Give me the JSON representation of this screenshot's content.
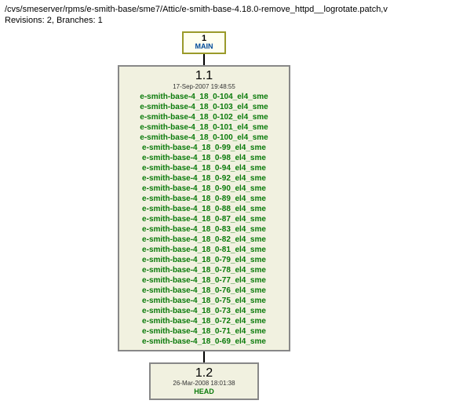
{
  "header": {
    "path": "/cvs/smeserver/rpms/e-smith-base/sme7/Attic/e-smith-base-4.18.0-remove_httpd__logrotate.patch,v",
    "revline": "Revisions: 2, Branches: 1"
  },
  "main": {
    "num": "1",
    "label": "MAIN"
  },
  "rev1": {
    "title": "1.1",
    "date": "17-Sep-2007 19:48:55",
    "tags": [
      "e-smith-base-4_18_0-104_el4_sme",
      "e-smith-base-4_18_0-103_el4_sme",
      "e-smith-base-4_18_0-102_el4_sme",
      "e-smith-base-4_18_0-101_el4_sme",
      "e-smith-base-4_18_0-100_el4_sme",
      "e-smith-base-4_18_0-99_el4_sme",
      "e-smith-base-4_18_0-98_el4_sme",
      "e-smith-base-4_18_0-94_el4_sme",
      "e-smith-base-4_18_0-92_el4_sme",
      "e-smith-base-4_18_0-90_el4_sme",
      "e-smith-base-4_18_0-89_el4_sme",
      "e-smith-base-4_18_0-88_el4_sme",
      "e-smith-base-4_18_0-87_el4_sme",
      "e-smith-base-4_18_0-83_el4_sme",
      "e-smith-base-4_18_0-82_el4_sme",
      "e-smith-base-4_18_0-81_el4_sme",
      "e-smith-base-4_18_0-79_el4_sme",
      "e-smith-base-4_18_0-78_el4_sme",
      "e-smith-base-4_18_0-77_el4_sme",
      "e-smith-base-4_18_0-76_el4_sme",
      "e-smith-base-4_18_0-75_el4_sme",
      "e-smith-base-4_18_0-73_el4_sme",
      "e-smith-base-4_18_0-72_el4_sme",
      "e-smith-base-4_18_0-71_el4_sme",
      "e-smith-base-4_18_0-69_el4_sme"
    ]
  },
  "rev2": {
    "title": "1.2",
    "date": "26-Mar-2008 18:01:38",
    "head": "HEAD"
  }
}
